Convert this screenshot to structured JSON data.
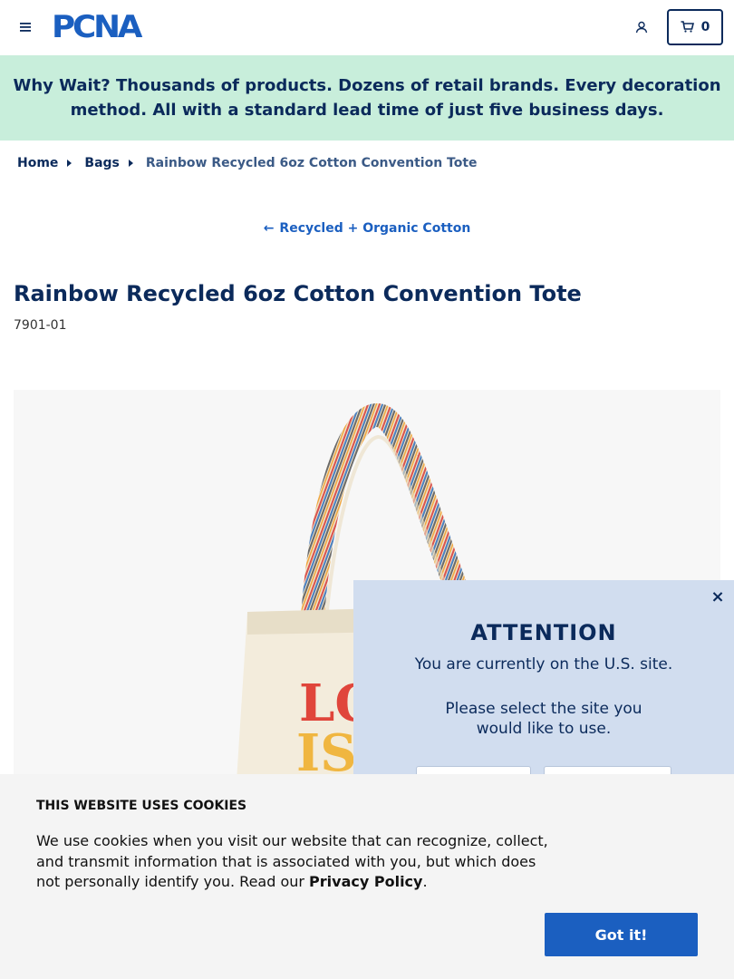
{
  "header": {
    "logo_text": "PCNA",
    "logo_tm": "™",
    "cart_count": "0"
  },
  "banner": {
    "lead": "Why Wait?",
    "text": " Thousands of products. Dozens of retail brands. Every decoration method. All with a standard lead time of just five business days."
  },
  "breadcrumb": {
    "items": [
      "Home",
      "Bags"
    ],
    "current": "Rainbow Recycled 6oz Cotton Convention Tote"
  },
  "category_link": {
    "arrow": "←",
    "label": "Recycled + Organic Cotton"
  },
  "product": {
    "title": "Rainbow Recycled 6oz Cotton Convention Tote",
    "sku": "7901-01",
    "print_text_line1": "LO",
    "print_text_line2": "IS"
  },
  "region_modal": {
    "close": "×",
    "heading": "ATTENTION",
    "line1": "You are currently on the U.S. site.",
    "line2": "Please select the site you",
    "line3": "would like to use."
  },
  "cookie_notice": {
    "title": "THIS WEBSITE USES COOKIES",
    "text": "We use cookies when you visit our website that can recognize, collect, and transmit information that is associated with you, but which does not personally identify you. Read our ",
    "link": "Privacy Policy",
    "end": ".",
    "button": "Got it!"
  },
  "colors": {
    "brand_blue": "#1b5fc0",
    "navy": "#0b2a5b",
    "banner_green": "#c8eedb",
    "modal_bg": "#d1ddef"
  }
}
